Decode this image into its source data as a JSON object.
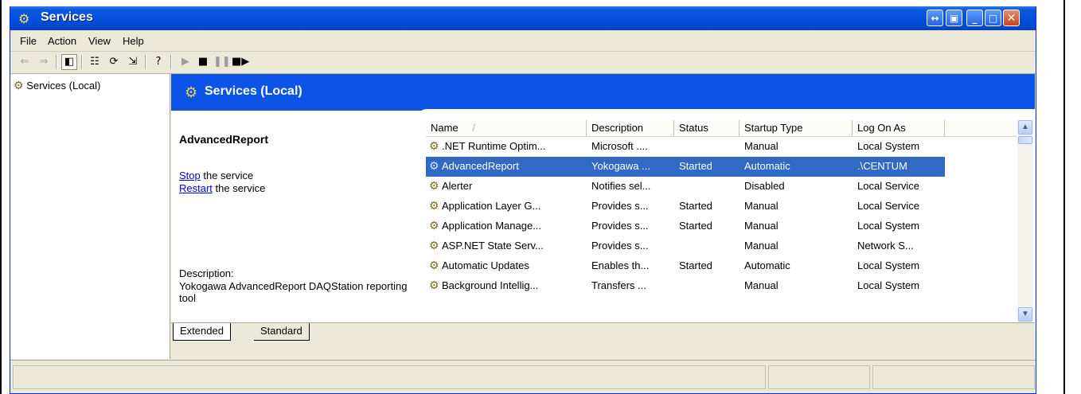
{
  "window": {
    "title": "Services",
    "icon": "services-gear-icon"
  },
  "title_buttons": [
    "extend-icon",
    "restore-panel-icon",
    "minimize-icon",
    "maximize-icon",
    "close-icon"
  ],
  "menu": [
    "File",
    "Action",
    "View",
    "Help"
  ],
  "toolbar": {
    "tools": [
      "back-arrow-icon",
      "forward-arrow-icon",
      "show-hide-tree-icon",
      "properties-icon",
      "refresh-icon",
      "export-list-icon",
      "help-icon",
      "start-service-icon",
      "stop-service-icon",
      "pause-service-icon",
      "restart-service-icon"
    ]
  },
  "tree": {
    "root": "Services (Local)"
  },
  "header": {
    "title": "Services (Local)"
  },
  "details": {
    "service_name": "AdvancedReport",
    "stop_link": "Stop",
    "stop_rest": " the service",
    "restart_link": "Restart",
    "restart_rest": " the service",
    "description_label": "Description:",
    "description_text": "Yokogawa AdvancedReport DAQStation reporting tool"
  },
  "columns": [
    "Name",
    "Description",
    "Status",
    "Startup Type",
    "Log On As"
  ],
  "sort_indicator": "/",
  "rows": [
    {
      "name": ".NET Runtime Optim...",
      "description": "Microsoft ....",
      "status": "",
      "startup": "Manual",
      "logon": "Local System"
    },
    {
      "name": "AdvancedReport",
      "description": "Yokogawa ...",
      "status": "Started",
      "startup": "Automatic",
      "logon": ".\\CENTUM"
    },
    {
      "name": "Alerter",
      "description": "Notifies sel...",
      "status": "",
      "startup": "Disabled",
      "logon": "Local Service"
    },
    {
      "name": "Application Layer G...",
      "description": "Provides s...",
      "status": "Started",
      "startup": "Manual",
      "logon": "Local Service"
    },
    {
      "name": "Application Manage...",
      "description": "Provides s...",
      "status": "Started",
      "startup": "Manual",
      "logon": "Local System"
    },
    {
      "name": "ASP.NET State Serv...",
      "description": "Provides s...",
      "status": "",
      "startup": "Manual",
      "logon": "Network S..."
    },
    {
      "name": "Automatic Updates",
      "description": "Enables th...",
      "status": "Started",
      "startup": "Automatic",
      "logon": "Local System"
    },
    {
      "name": "Background Intellig...",
      "description": "Transfers ...",
      "status": "",
      "startup": "Manual",
      "logon": "Local System"
    }
  ],
  "selected_row": 1,
  "tabs": [
    "Extended",
    "Standard"
  ],
  "active_tab": "Extended"
}
